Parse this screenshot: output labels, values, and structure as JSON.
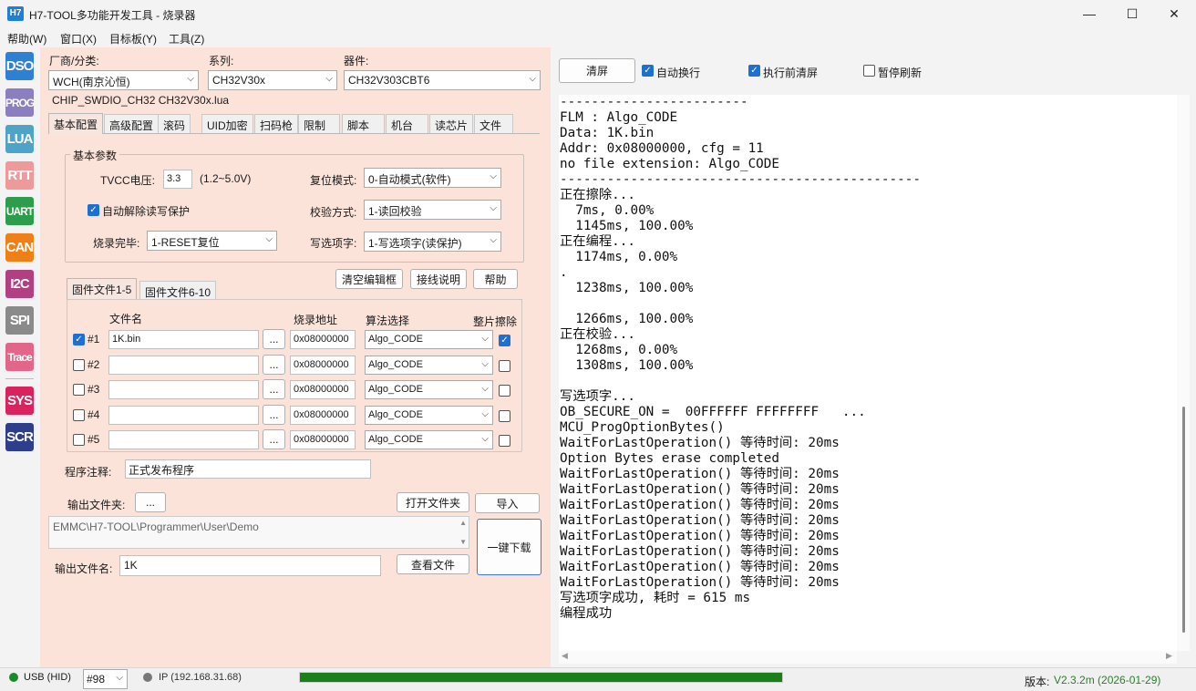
{
  "window": {
    "app_icon": "H7",
    "title": "H7-TOOL多功能开发工具 - 烧录器",
    "minimize": "—",
    "maximize": "☐",
    "close": "✕"
  },
  "menu": [
    "帮助(W)",
    "窗口(X)",
    "目标板(Y)",
    "工具(Z)"
  ],
  "sidebar": [
    {
      "label": "DSO",
      "color": "#2f7fd2"
    },
    {
      "label": "PROG",
      "color": "#8c7fc0"
    },
    {
      "label": "LUA",
      "color": "#4fa3c7"
    },
    {
      "label": "RTT",
      "color": "#ef9a9a"
    },
    {
      "label": "UART",
      "color": "#2e9d4b"
    },
    {
      "label": "CAN",
      "color": "#f07f16"
    },
    {
      "label": "I2C",
      "color": "#b13f82"
    },
    {
      "label": "SPI",
      "color": "#8a8a8a"
    },
    {
      "label": "Trace",
      "color": "#e3668a"
    },
    {
      "label": "SYS",
      "color": "#d8235f"
    },
    {
      "label": "SCR",
      "color": "#2d3f8c"
    }
  ],
  "selector": {
    "vendor_label": "厂商/分类:",
    "vendor_value": "WCH(南京沁恒)",
    "series_label": "系列:",
    "series_value": "CH32V30x",
    "device_label": "器件:",
    "device_value": "CH32V303CBT6",
    "lua_file": "CHIP_SWDIO_CH32  CH32V30x.lua"
  },
  "tabs": [
    "基本配置",
    "高级配置",
    "滚码",
    "UID加密",
    "扫码枪",
    "限制",
    "脚本",
    "机台",
    "读芯片",
    "文件"
  ],
  "basic": {
    "group_title": "基本参数",
    "tvcc_label": "TVCC电压:",
    "tvcc_value": "3.3",
    "tvcc_range": "(1.2~5.0V)",
    "auto_unlock_label": "自动解除读写保护",
    "finish_label": "烧录完毕:",
    "finish_value": "1-RESET复位",
    "reset_label": "复位模式:",
    "reset_value": "0-自动模式(软件)",
    "verify_label": "校验方式:",
    "verify_value": "1-读回校验",
    "option_label": "写选项字:",
    "option_value": "1-写选项字(读保护)"
  },
  "actions": {
    "clear_edit": "清空编辑框",
    "wiring": "接线说明",
    "help": "帮助"
  },
  "file_tabs": [
    "固件文件1-5",
    "固件文件6-10"
  ],
  "file_table": {
    "headers": [
      "文件名",
      "烧录地址",
      "算法选择",
      "整片擦除"
    ],
    "rows": [
      {
        "id": "#1",
        "checked": true,
        "file": "1K.bin",
        "browse": "...",
        "addr": "0x08000000",
        "algo": "Algo_CODE",
        "erase": true
      },
      {
        "id": "#2",
        "checked": false,
        "file": "",
        "browse": "...",
        "addr": "0x08000000",
        "algo": "Algo_CODE",
        "erase": false
      },
      {
        "id": "#3",
        "checked": false,
        "file": "",
        "browse": "...",
        "addr": "0x08000000",
        "algo": "Algo_CODE",
        "erase": false
      },
      {
        "id": "#4",
        "checked": false,
        "file": "",
        "browse": "...",
        "addr": "0x08000000",
        "algo": "Algo_CODE",
        "erase": false
      },
      {
        "id": "#5",
        "checked": false,
        "file": "",
        "browse": "...",
        "addr": "0x08000000",
        "algo": "Algo_CODE",
        "erase": false
      }
    ]
  },
  "comment": {
    "label": "程序注释:",
    "value": "正式发布程序"
  },
  "output": {
    "folder_label": "输出文件夹:",
    "folder_browse": "...",
    "open_folder": "打开文件夹",
    "import": "导入",
    "path": "EMMC\\H7-TOOL\\Programmer\\User\\Demo",
    "name_label": "输出文件名:",
    "name_value": "1K",
    "view_file": "查看文件",
    "download": "一键下载"
  },
  "log_toolbar": {
    "clear": "清屏",
    "auto_wrap": "自动换行",
    "auto_wrap_checked": true,
    "clear_before": "执行前清屏",
    "clear_before_checked": true,
    "pause": "暂停刷新",
    "pause_checked": false
  },
  "log_lines": [
    "------------------------",
    "FLM : Algo_CODE",
    "Data: 1K.bin",
    "Addr: 0x08000000, cfg = 11",
    "no file extension: Algo_CODE",
    "----------------------------------------------",
    "正在擦除...",
    "  7ms, 0.00%",
    "  1145ms, 100.00%",
    "正在编程...",
    "  1174ms, 0.00%",
    ".",
    "  1238ms, 100.00%",
    "",
    "  1266ms, 100.00%",
    "正在校验...",
    "  1268ms, 0.00%",
    "  1308ms, 100.00%",
    "",
    "写选项字...",
    "OB_SECURE_ON =  00FFFFFF FFFFFFFF   ...",
    "MCU_ProgOptionBytes()",
    "WaitForLastOperation() 等待时间: 20ms",
    "Option Bytes erase completed",
    "WaitForLastOperation() 等待时间: 20ms",
    "WaitForLastOperation() 等待时间: 20ms",
    "WaitForLastOperation() 等待时间: 20ms",
    "WaitForLastOperation() 等待时间: 20ms",
    "WaitForLastOperation() 等待时间: 20ms",
    "WaitForLastOperation() 等待时间: 20ms",
    "WaitForLastOperation() 等待时间: 20ms",
    "WaitForLastOperation() 等待时间: 20ms",
    "写选项字成功, 耗时 = 615 ms",
    "编程成功"
  ],
  "status": {
    "usb": "USB (HID)",
    "usb_color": "#1a8a2a",
    "device_no": "#98",
    "ip": "IP (192.168.31.68)",
    "ip_color": "#777777",
    "progress": 1.0,
    "progress_color": "#1a7f1a",
    "version_label": "版本:",
    "version": "V2.3.2m (2026-01-29)",
    "version_color": "#2a7f2a"
  }
}
